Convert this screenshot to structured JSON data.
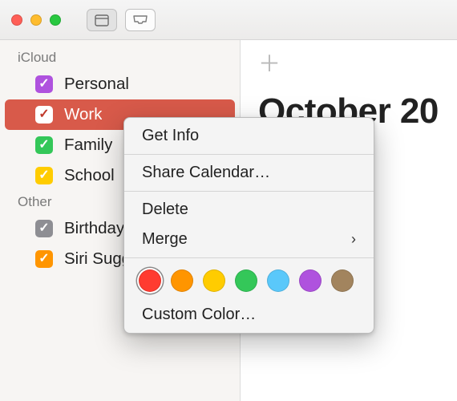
{
  "toolbar_icons": {
    "calendars": "calendar-icon",
    "inbox": "tray-icon"
  },
  "sidebar": {
    "sections": [
      {
        "title": "iCloud",
        "items": [
          {
            "label": "Personal",
            "color": "#af52de",
            "checked": true,
            "selected": false
          },
          {
            "label": "Work",
            "color": "#ffffff",
            "checked": true,
            "selected": true,
            "checkfg": "#c0392b"
          },
          {
            "label": "Family",
            "color": "#34c759",
            "checked": true,
            "selected": false
          },
          {
            "label": "School",
            "color": "#ffcc00",
            "checked": true,
            "selected": false
          }
        ]
      },
      {
        "title": "Other",
        "items": [
          {
            "label": "Birthdays",
            "color": "#8e8e93",
            "checked": true,
            "selected": false
          },
          {
            "label": "Siri Suggestions",
            "color": "#ff9500",
            "checked": true,
            "selected": false
          }
        ]
      }
    ]
  },
  "month_title": "October 20",
  "context_menu": {
    "get_info": "Get Info",
    "share": "Share Calendar…",
    "delete": "Delete",
    "merge": "Merge",
    "custom_color": "Custom Color…",
    "swatches": [
      {
        "color": "#ff3b30",
        "selected": true
      },
      {
        "color": "#ff9500",
        "selected": false
      },
      {
        "color": "#ffcc00",
        "selected": false
      },
      {
        "color": "#34c759",
        "selected": false
      },
      {
        "color": "#5ac8fa",
        "selected": false
      },
      {
        "color": "#af52de",
        "selected": false
      },
      {
        "color": "#a2845e",
        "selected": false
      }
    ]
  }
}
